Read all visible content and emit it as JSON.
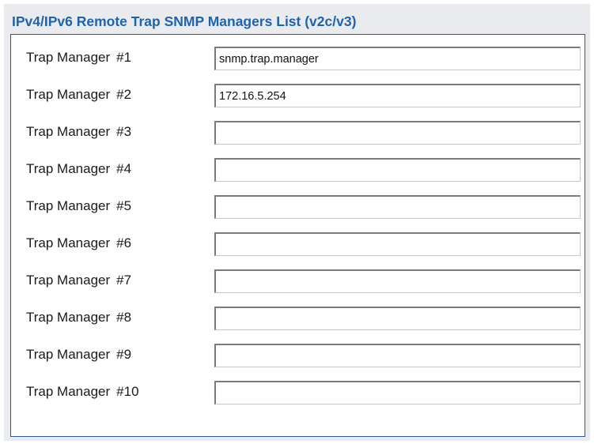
{
  "panel": {
    "title": "IPv4/IPv6 Remote Trap SNMP Managers List (v2c/v3)"
  },
  "managers": [
    {
      "label": "Trap Manager",
      "number": "#1",
      "value": "snmp.trap.manager"
    },
    {
      "label": "Trap Manager",
      "number": "#2",
      "value": "172.16.5.254"
    },
    {
      "label": "Trap Manager",
      "number": "#3",
      "value": ""
    },
    {
      "label": "Trap Manager",
      "number": "#4",
      "value": ""
    },
    {
      "label": "Trap Manager",
      "number": "#5",
      "value": ""
    },
    {
      "label": "Trap Manager",
      "number": "#6",
      "value": ""
    },
    {
      "label": "Trap Manager",
      "number": "#7",
      "value": ""
    },
    {
      "label": "Trap Manager",
      "number": "#8",
      "value": ""
    },
    {
      "label": "Trap Manager",
      "number": "#9",
      "value": ""
    },
    {
      "label": "Trap Manager",
      "number": "#10",
      "value": ""
    }
  ],
  "colors": {
    "title": "#1f63ad",
    "panel_background": "#e9ebee",
    "inner_border": "#2c5c8c"
  }
}
